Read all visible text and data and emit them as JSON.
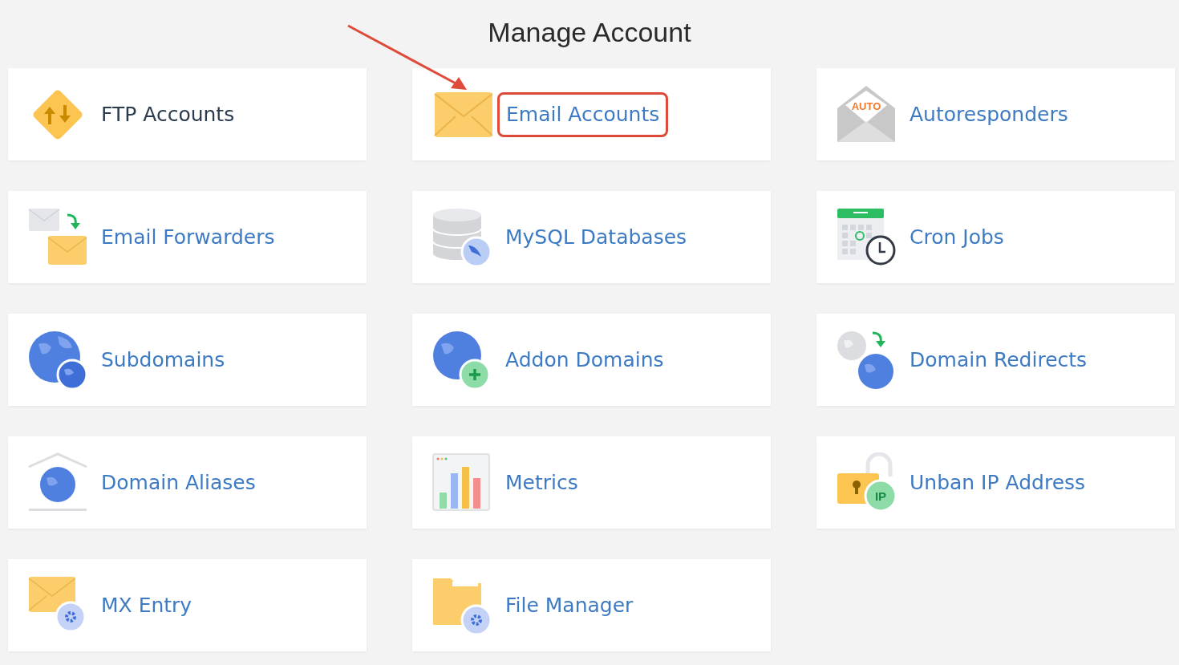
{
  "title": "Manage Account",
  "tiles": [
    {
      "kind": "ftp",
      "label": "FTP Accounts",
      "hovered": true,
      "highlighted": false
    },
    {
      "kind": "email",
      "label": "Email Accounts",
      "hovered": false,
      "highlighted": true
    },
    {
      "kind": "autoresponder",
      "label": "Autoresponders",
      "badge": "AUTO",
      "hovered": false,
      "highlighted": false
    },
    {
      "kind": "forwarder",
      "label": "Email Forwarders",
      "hovered": false,
      "highlighted": false
    },
    {
      "kind": "database",
      "label": "MySQL Databases",
      "hovered": false,
      "highlighted": false
    },
    {
      "kind": "cron",
      "label": "Cron Jobs",
      "hovered": false,
      "highlighted": false
    },
    {
      "kind": "subdomain",
      "label": "Subdomains",
      "hovered": false,
      "highlighted": false
    },
    {
      "kind": "addon",
      "label": "Addon Domains",
      "hovered": false,
      "highlighted": false
    },
    {
      "kind": "redirect",
      "label": "Domain Redirects",
      "hovered": false,
      "highlighted": false
    },
    {
      "kind": "alias",
      "label": "Domain Aliases",
      "hovered": false,
      "highlighted": false
    },
    {
      "kind": "metrics",
      "label": "Metrics",
      "hovered": false,
      "highlighted": false
    },
    {
      "kind": "unban",
      "label": "Unban IP Address",
      "badge": "IP",
      "hovered": false,
      "highlighted": false
    },
    {
      "kind": "mx",
      "label": "MX Entry",
      "hovered": false,
      "highlighted": false
    },
    {
      "kind": "files",
      "label": "File Manager",
      "hovered": false,
      "highlighted": false
    }
  ]
}
